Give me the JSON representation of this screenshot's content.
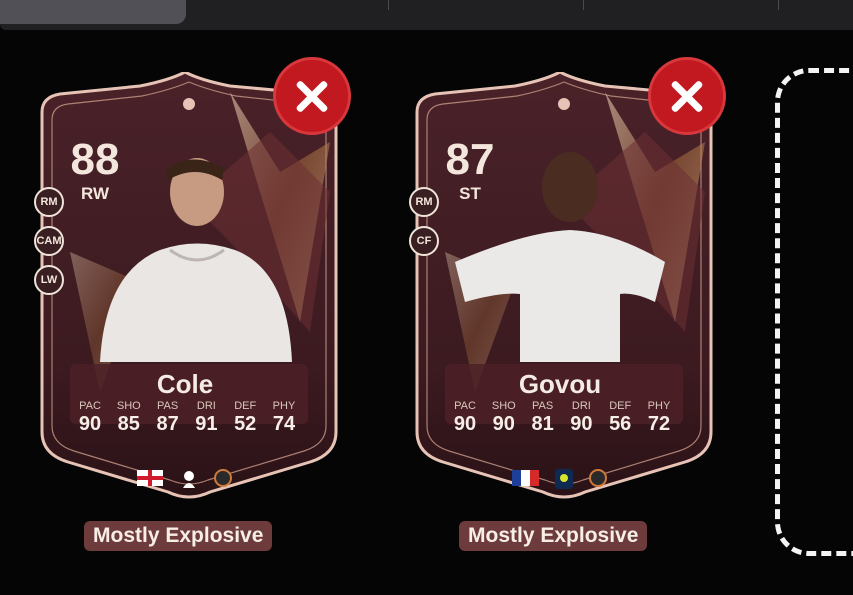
{
  "cards": [
    {
      "rating": "88",
      "position": "RW",
      "alt_positions": [
        "RM",
        "CAM",
        "LW"
      ],
      "name": "Cole",
      "stats": [
        {
          "label": "PAC",
          "value": "90"
        },
        {
          "label": "SHO",
          "value": "85"
        },
        {
          "label": "PAS",
          "value": "87"
        },
        {
          "label": "DRI",
          "value": "91"
        },
        {
          "label": "DEF",
          "value": "52"
        },
        {
          "label": "PHY",
          "value": "74"
        }
      ],
      "nation_icon": "england-flag-icon",
      "league_icon": "premier-league-icon",
      "club_icon": "club-crest-icon",
      "chemistry_style": "Mostly Explosive"
    },
    {
      "rating": "87",
      "position": "ST",
      "alt_positions": [
        "RM",
        "CF"
      ],
      "name": "Govou",
      "stats": [
        {
          "label": "PAC",
          "value": "90"
        },
        {
          "label": "SHO",
          "value": "90"
        },
        {
          "label": "PAS",
          "value": "81"
        },
        {
          "label": "DRI",
          "value": "90"
        },
        {
          "label": "DEF",
          "value": "56"
        },
        {
          "label": "PHY",
          "value": "72"
        }
      ],
      "nation_icon": "france-flag-icon",
      "league_icon": "ligue-1-icon",
      "club_icon": "club-crest-icon",
      "chemistry_style": "Mostly Explosive"
    }
  ],
  "colors": {
    "card_bg": "#3b1c22",
    "card_border": "#e7c3b6",
    "remove_button": "#c2181f",
    "chemistry_badge": "#6e3b3c"
  }
}
